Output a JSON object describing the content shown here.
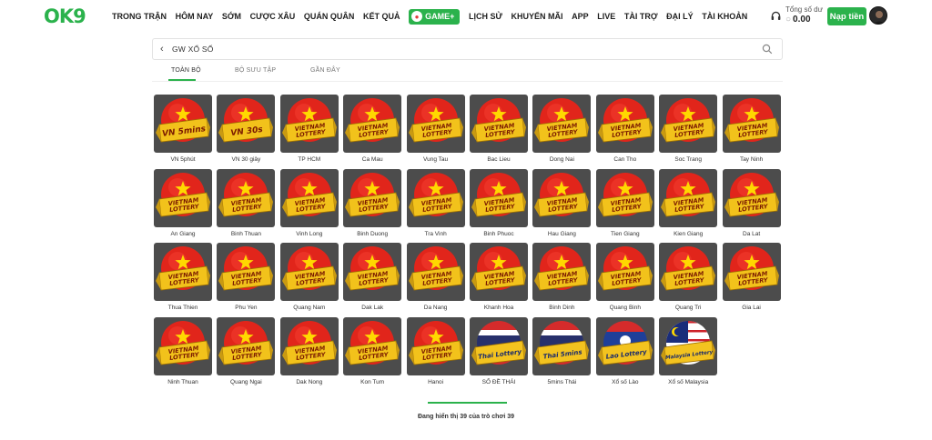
{
  "header": {
    "logo": "OK9",
    "nav": [
      "TRONG TRẬN",
      "HÔM NAY",
      "SỚM",
      "CƯỢC XÂU",
      "QUÁN QUÂN",
      "KẾT QUẢ"
    ],
    "game_label": "GAME+",
    "nav_after": [
      "LỊCH SỬ",
      "KHUYẾN MÃI",
      "APP",
      "LIVE",
      "TÀI TRỢ",
      "ĐẠI LÝ",
      "TÀI KHOẢN"
    ],
    "balance_label": "Tổng số dư",
    "balance_amount": "0.00",
    "deposit_label": "Nạp tiền"
  },
  "search": {
    "title": "GW XỔ SỐ"
  },
  "tabs": [
    {
      "label": "TOÀN BỘ",
      "active": true
    },
    {
      "label": "BỘ SƯU TẬP",
      "active": false
    },
    {
      "label": "GẦN ĐÂY",
      "active": false
    }
  ],
  "games": [
    {
      "label": "VN 5phút",
      "banner": "VN 5mins",
      "style": "vn"
    },
    {
      "label": "VN 30 giây",
      "banner": "VN 30s",
      "style": "vn"
    },
    {
      "label": "TP HCM",
      "banner": "VIETNAM LOTTERY",
      "style": "vn"
    },
    {
      "label": "Ca Mau",
      "banner": "VIETNAM LOTTERY",
      "style": "vn"
    },
    {
      "label": "Vung Tau",
      "banner": "VIETNAM LOTTERY",
      "style": "vn"
    },
    {
      "label": "Bac Lieu",
      "banner": "VIETNAM LOTTERY",
      "style": "vn"
    },
    {
      "label": "Dong Nai",
      "banner": "VIETNAM LOTTERY",
      "style": "vn"
    },
    {
      "label": "Can Tho",
      "banner": "VIETNAM LOTTERY",
      "style": "vn"
    },
    {
      "label": "Soc Trang",
      "banner": "VIETNAM LOTTERY",
      "style": "vn"
    },
    {
      "label": "Tay Ninh",
      "banner": "VIETNAM LOTTERY",
      "style": "vn"
    },
    {
      "label": "An Giang",
      "banner": "VIETNAM LOTTERY",
      "style": "vn"
    },
    {
      "label": "Binh Thuan",
      "banner": "VIETNAM LOTTERY",
      "style": "vn"
    },
    {
      "label": "Vinh Long",
      "banner": "VIETNAM LOTTERY",
      "style": "vn"
    },
    {
      "label": "Binh Duong",
      "banner": "VIETNAM LOTTERY",
      "style": "vn"
    },
    {
      "label": "Tra Vinh",
      "banner": "VIETNAM LOTTERY",
      "style": "vn"
    },
    {
      "label": "Binh Phuoc",
      "banner": "VIETNAM LOTTERY",
      "style": "vn"
    },
    {
      "label": "Hau Giang",
      "banner": "VIETNAM LOTTERY",
      "style": "vn"
    },
    {
      "label": "Tien Giang",
      "banner": "VIETNAM LOTTERY",
      "style": "vn"
    },
    {
      "label": "Kien Giang",
      "banner": "VIETNAM LOTTERY",
      "style": "vn"
    },
    {
      "label": "Da Lat",
      "banner": "VIETNAM LOTTERY",
      "style": "vn"
    },
    {
      "label": "Thua Thien",
      "banner": "VIETNAM LOTTERY",
      "style": "vn"
    },
    {
      "label": "Phu Yen",
      "banner": "VIETNAM LOTTERY",
      "style": "vn"
    },
    {
      "label": "Quang Nam",
      "banner": "VIETNAM LOTTERY",
      "style": "vn"
    },
    {
      "label": "Dak Lak",
      "banner": "VIETNAM LOTTERY",
      "style": "vn"
    },
    {
      "label": "Da Nang",
      "banner": "VIETNAM LOTTERY",
      "style": "vn"
    },
    {
      "label": "Khanh Hoa",
      "banner": "VIETNAM LOTTERY",
      "style": "vn"
    },
    {
      "label": "Binh Dinh",
      "banner": "VIETNAM LOTTERY",
      "style": "vn"
    },
    {
      "label": "Quang Binh",
      "banner": "VIETNAM LOTTERY",
      "style": "vn"
    },
    {
      "label": "Quang Tri",
      "banner": "VIETNAM LOTTERY",
      "style": "vn"
    },
    {
      "label": "Gia Lai",
      "banner": "VIETNAM LOTTERY",
      "style": "vn"
    },
    {
      "label": "Ninh Thuan",
      "banner": "VIETNAM LOTTERY",
      "style": "vn"
    },
    {
      "label": "Quang Ngai",
      "banner": "VIETNAM LOTTERY",
      "style": "vn"
    },
    {
      "label": "Dak Nong",
      "banner": "VIETNAM LOTTERY",
      "style": "vn"
    },
    {
      "label": "Kon Tum",
      "banner": "VIETNAM LOTTERY",
      "style": "vn"
    },
    {
      "label": "Hanoi",
      "banner": "VIETNAM LOTTERY",
      "style": "vn"
    },
    {
      "label": "SỐ ĐỀ THÁI",
      "banner": "Thai Lottery",
      "style": "thai"
    },
    {
      "label": "5mins Thái",
      "banner": "Thai 5mins",
      "style": "thai"
    },
    {
      "label": "Xổ số Lào",
      "banner": "Lao Lottery",
      "style": "lao"
    },
    {
      "label": "Xổ số Malaysia",
      "banner": "Malaysia Lottery",
      "style": "malaysia"
    }
  ],
  "footer": {
    "text": "Đang hiển thị 39 của trò chơi 39",
    "shown": 39,
    "total": 39
  },
  "colors": {
    "brand_green": "#2bb24c",
    "tile_bg": "#4c4c4c",
    "flag_red": "#e1251b",
    "star_yellow": "#ffd800",
    "ribbon_yellow": "#f2c21b"
  }
}
